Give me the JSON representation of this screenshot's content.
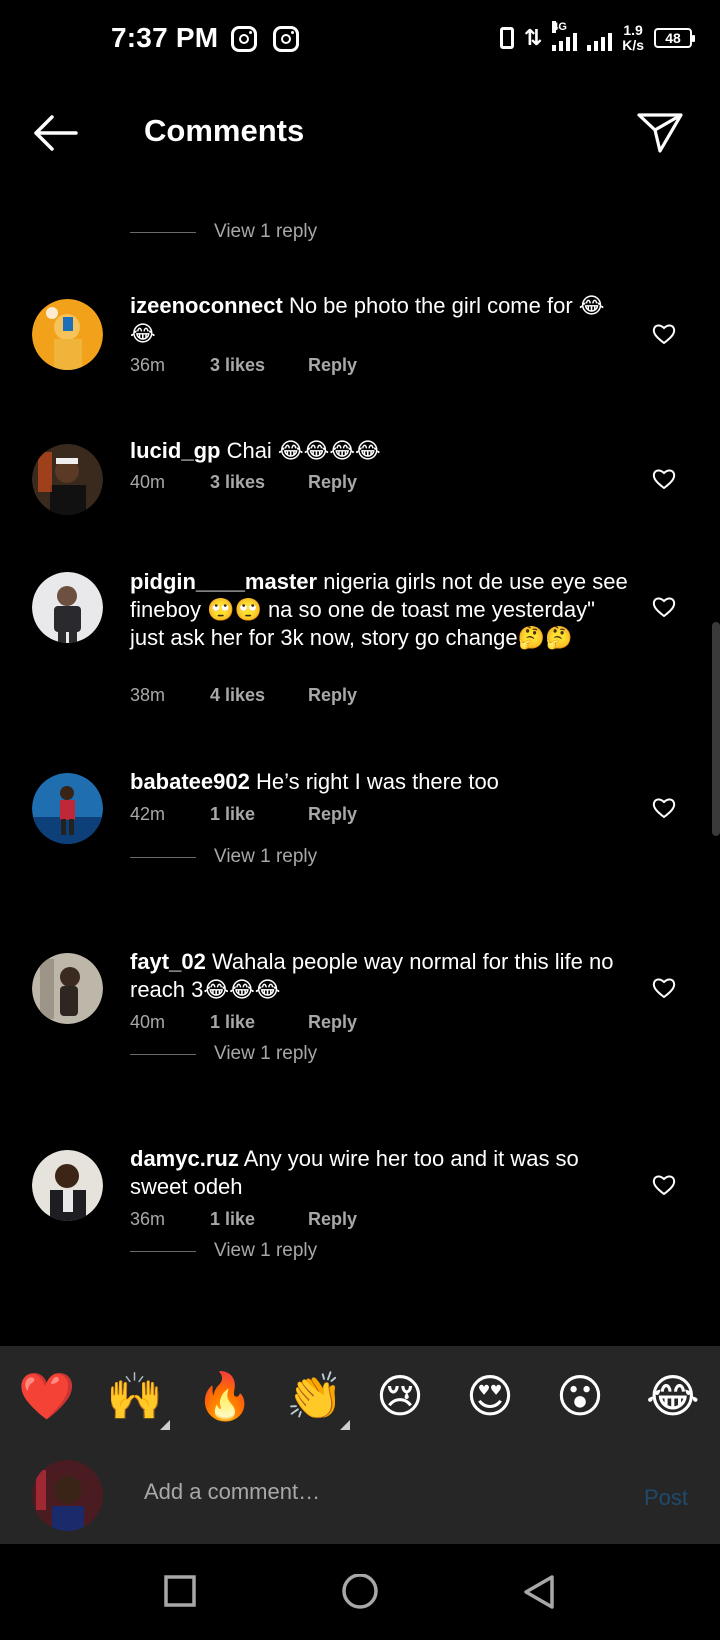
{
  "status_bar": {
    "time": "7:37 PM",
    "network": "4G",
    "speed_value": "1.9",
    "speed_unit": "K/s",
    "battery": "48"
  },
  "header": {
    "title": "Comments"
  },
  "view_reply_label": "View 1 reply",
  "comments": [
    {
      "user": "izeenoconnect",
      "text": "No be photo the girl come for 😂😂",
      "time": "36m",
      "likes": "3 likes",
      "reply": "Reply"
    },
    {
      "user": "lucid_gp",
      "text": "Chai 😂😂😂😂",
      "time": "40m",
      "likes": "3 likes",
      "reply": "Reply"
    },
    {
      "user": "pidgin____master",
      "text": "nigeria girls not de use eye see fineboy 🙄🙄 na so one de toast me yesterday\" just ask her for 3k now, story go change🤔🤔",
      "time": "38m",
      "likes": "4 likes",
      "reply": "Reply"
    },
    {
      "user": "babatee902",
      "text": "He’s right I was there too",
      "time": "42m",
      "likes": "1 like",
      "reply": "Reply"
    },
    {
      "user": "fayt_02",
      "text": "Wahala people way normal for this life no reach 3😂😂😂",
      "time": "40m",
      "likes": "1 like",
      "reply": "Reply"
    },
    {
      "user": "damyc.ruz",
      "text": "Any you wire her too and it was so sweet odeh",
      "time": "36m",
      "likes": "1 like",
      "reply": "Reply"
    }
  ],
  "reactions": [
    "❤️",
    "🙌",
    "🔥",
    "👏",
    "😢",
    "😍",
    "😮",
    "😂"
  ],
  "compose": {
    "placeholder": "Add a comment…",
    "post_label": "Post"
  },
  "colors": {
    "background": "#000000",
    "panel": "#262626",
    "muted_text": "#a8a8a8",
    "post_disabled": "#1f4a6b"
  }
}
